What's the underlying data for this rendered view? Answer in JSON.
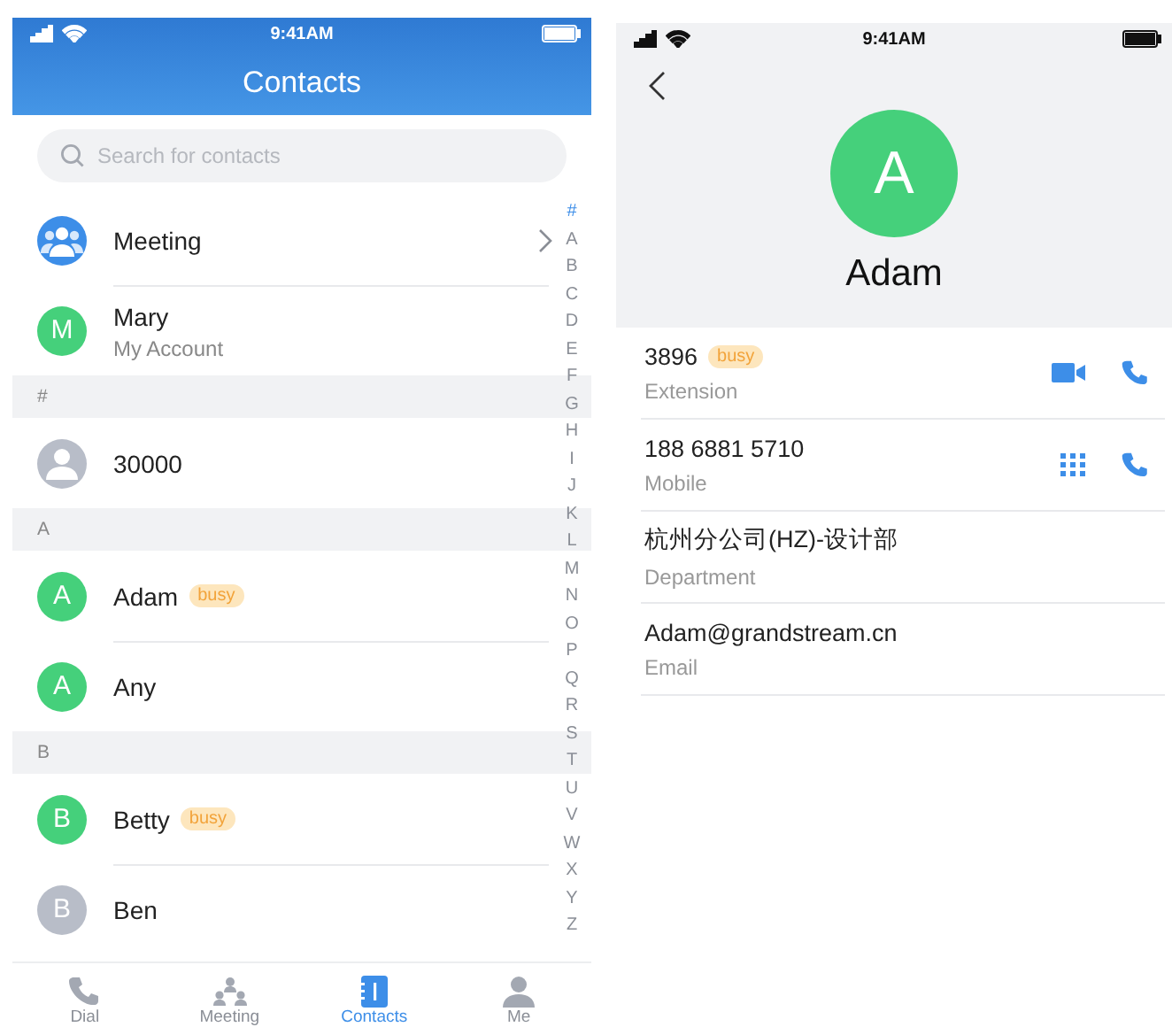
{
  "contacts_screen": {
    "status_bar": {
      "time": "9:41AM"
    },
    "title": "Contacts",
    "search": {
      "placeholder": "Search for contacts"
    },
    "list": [
      {
        "kind": "contact",
        "avatar": {
          "kind": "group",
          "color": "#3d8ee8"
        },
        "name": "Meeting",
        "chevron": true
      },
      {
        "kind": "contact",
        "avatar": {
          "kind": "letter",
          "initial": "M",
          "color": "#45d07b"
        },
        "name": "Mary",
        "subtitle": "My Account"
      },
      {
        "kind": "section",
        "label": "#"
      },
      {
        "kind": "contact",
        "avatar": {
          "kind": "person",
          "color": "#b8bdc8"
        },
        "name": "30000"
      },
      {
        "kind": "section",
        "label": "A"
      },
      {
        "kind": "contact",
        "avatar": {
          "kind": "letter",
          "initial": "A",
          "color": "#45d07b"
        },
        "name": "Adam",
        "badge": "busy"
      },
      {
        "kind": "contact",
        "avatar": {
          "kind": "letter",
          "initial": "A",
          "color": "#45d07b"
        },
        "name": "Any"
      },
      {
        "kind": "section",
        "label": "B"
      },
      {
        "kind": "contact",
        "avatar": {
          "kind": "letter",
          "initial": "B",
          "color": "#45d07b"
        },
        "name": "Betty",
        "badge": "busy"
      },
      {
        "kind": "contact",
        "avatar": {
          "kind": "letter",
          "initial": "B",
          "color": "#b8bdc8"
        },
        "name": "Ben"
      }
    ],
    "index": [
      {
        "label": "#",
        "selected": true
      },
      {
        "label": "A",
        "selected": false
      },
      {
        "label": "B",
        "selected": false
      },
      {
        "label": "C",
        "selected": false
      },
      {
        "label": "D",
        "selected": false
      },
      {
        "label": "E",
        "selected": false
      },
      {
        "label": "F",
        "selected": false
      },
      {
        "label": "G",
        "selected": false
      },
      {
        "label": "H",
        "selected": false
      },
      {
        "label": "I",
        "selected": false
      },
      {
        "label": "J",
        "selected": false
      },
      {
        "label": "K",
        "selected": false
      },
      {
        "label": "L",
        "selected": false
      },
      {
        "label": "M",
        "selected": false
      },
      {
        "label": "N",
        "selected": false
      },
      {
        "label": "O",
        "selected": false
      },
      {
        "label": "P",
        "selected": false
      },
      {
        "label": "Q",
        "selected": false
      },
      {
        "label": "R",
        "selected": false
      },
      {
        "label": "S",
        "selected": false
      },
      {
        "label": "T",
        "selected": false
      },
      {
        "label": "U",
        "selected": false
      },
      {
        "label": "V",
        "selected": false
      },
      {
        "label": "W",
        "selected": false
      },
      {
        "label": "X",
        "selected": false
      },
      {
        "label": "Y",
        "selected": false
      },
      {
        "label": "Z",
        "selected": false
      }
    ],
    "tabs": [
      {
        "kind": "dial",
        "label": "Dial",
        "selected": false
      },
      {
        "kind": "meeting",
        "label": "Meeting",
        "selected": false
      },
      {
        "kind": "contacts",
        "label": "Contacts",
        "selected": true
      },
      {
        "kind": "me",
        "label": "Me",
        "selected": false
      }
    ]
  },
  "detail_screen": {
    "status_bar": {
      "time": "9:41AM"
    },
    "avatar": {
      "initial": "A",
      "color": "#45d07b"
    },
    "name": "Adam",
    "fields": [
      {
        "value": "3896",
        "badge": "busy",
        "label": "Extension",
        "actions": [
          {
            "kind": "video"
          },
          {
            "kind": "call"
          }
        ]
      },
      {
        "value": "188 6881 5710",
        "label": "Mobile",
        "actions": [
          {
            "kind": "keypad"
          },
          {
            "kind": "call"
          }
        ]
      },
      {
        "value": "杭州分公司(HZ)-设计部",
        "label": "Department"
      },
      {
        "value": "Adam@grandstream.cn",
        "label": "Email"
      }
    ]
  }
}
